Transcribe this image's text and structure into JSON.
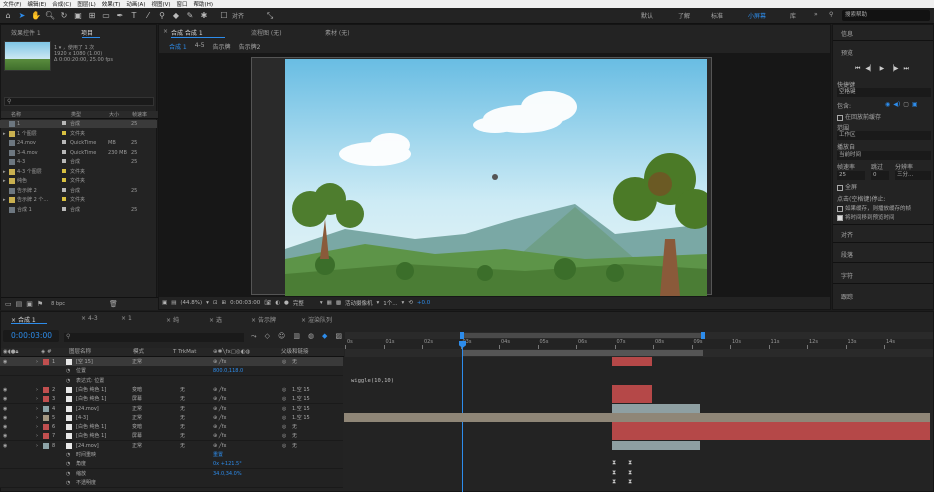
{
  "menu": [
    "文件(F)",
    "编辑(E)",
    "合成(C)",
    "图层(L)",
    "效果(T)",
    "动画(A)",
    "视图(V)",
    "窗口",
    "帮助(H)"
  ],
  "toolbar": {
    "align_label": "对齐",
    "workspaces": [
      "默认",
      "了解",
      "标准",
      "小屏幕",
      "库"
    ],
    "active_workspace": "小屏幕",
    "search_help": "搜索帮助"
  },
  "project_panel": {
    "tabs": [
      "效果控件 1",
      "项目"
    ],
    "item_info": {
      "name": "1",
      "used": "，使用了 1 次",
      "dims": "1920 x 1080 (1.00)",
      "duration": "Δ 0:00:20:00, 25.00 fps"
    },
    "search_placeholder": "",
    "columns": [
      "名称",
      "类型",
      "大小",
      "帧速率"
    ],
    "items": [
      {
        "name": "1",
        "type": "合成",
        "size": "",
        "fps": "25",
        "color": "#b8b8b8"
      },
      {
        "name": "1 个图层",
        "type": "文件夹",
        "size": "",
        "fps": "",
        "color": "#d8c040"
      },
      {
        "name": "24.mov",
        "type": "QuickTime",
        "size": "MB",
        "fps": "25",
        "color": "#b8b8b8"
      },
      {
        "name": "3-4.mov",
        "type": "QuickTime",
        "size": "230 MB",
        "fps": "25",
        "color": "#b8b8b8"
      },
      {
        "name": "4-3",
        "type": "合成",
        "size": "",
        "fps": "25",
        "color": "#b8b8b8"
      },
      {
        "name": "4-3 个图层",
        "type": "文件夹",
        "size": "",
        "fps": "",
        "color": "#d8c040"
      },
      {
        "name": "纯色",
        "type": "文件夹",
        "size": "",
        "fps": "",
        "color": "#d8c040"
      },
      {
        "name": "告示牌 2",
        "type": "合成",
        "size": "",
        "fps": "25",
        "color": "#b8b8b8"
      },
      {
        "name": "告示牌 2 个...",
        "type": "文件夹",
        "size": "",
        "fps": "",
        "color": "#d8c040"
      },
      {
        "name": "合成 1",
        "type": "合成",
        "size": "",
        "fps": "25",
        "color": "#b8b8b8"
      }
    ],
    "bpc": "8 bpc"
  },
  "comp_panel": {
    "tabs": [
      "合成 合成 1",
      "流程图 (无)",
      "素材 (无)"
    ],
    "breadcrumbs": [
      "合成 1",
      "4-5",
      "告示牌",
      "告示牌2"
    ],
    "zoom": "(44.8%)",
    "timecode": "0:00:03:00",
    "quality": "完整",
    "camera": "活动摄像机",
    "views": "1个...",
    "exposure": "+0.0"
  },
  "right_panel": {
    "info": "信息",
    "preview": "预览",
    "shortcut_label": "快捷键",
    "shortcut_value": "空格键",
    "include_label": "包含:",
    "cache_label": "在回放前缓存",
    "range_label": "范围",
    "range_value": "工作区",
    "playfrom_label": "播放自",
    "playfrom_value": "当前时间",
    "fps_label": "帧速率",
    "skip_label": "跳过",
    "res_label": "分辨率",
    "fps_value": "25",
    "skip_value": "0",
    "res_value": "三分...",
    "fullscreen_label": "全屏",
    "stop_label": "点击(空格键)停止:",
    "opt1": "如果缓存，则播放缓存的帧",
    "opt2": "将时间移到预览时间",
    "sections": [
      "对齐",
      "段落",
      "字符",
      "跟踪"
    ]
  },
  "timeline": {
    "tabs": [
      "合成 1",
      "4-3",
      "1",
      "纯",
      "选",
      "告示牌",
      "渲染队列"
    ],
    "timecode": "0:00:03:00",
    "fps_sub": "00075 (25.00 fps)",
    "columns": [
      "图层名称",
      "模式",
      "T TrkMat",
      "父级和链接"
    ],
    "ruler": [
      "0s",
      "01s",
      "02s",
      "03s",
      "04s",
      "05s",
      "06s",
      "07s",
      "08s",
      "09s",
      "10s",
      "11s",
      "12s",
      "13s",
      "14s"
    ],
    "expression": "wiggle(10,10)",
    "rows": [
      {
        "num": "1",
        "name": "[空 15]",
        "mode": "正常",
        "trk": "",
        "parent": "无",
        "color": "#c14f4f",
        "kind": "layer"
      },
      {
        "num": "",
        "name": "位置",
        "mode": "",
        "trk": "",
        "parent": "",
        "value": "800.0,118.0",
        "kind": "prop"
      },
      {
        "num": "",
        "name": "表达式: 位置",
        "mode": "",
        "trk": "",
        "parent": "",
        "value": "",
        "kind": "prop"
      },
      {
        "num": "2",
        "name": "[白色 纯色 1]",
        "mode": "变暗",
        "trk": "无",
        "parent": "1.空 15",
        "color": "#c14f4f",
        "kind": "layer"
      },
      {
        "num": "3",
        "name": "[白色 纯色 1]",
        "mode": "屏幕",
        "trk": "无",
        "parent": "1.空 15",
        "color": "#c14f4f",
        "kind": "layer"
      },
      {
        "num": "4",
        "name": "[24.mov]",
        "mode": "正常",
        "trk": "无",
        "parent": "1.空 15",
        "color": "#8ea4a8",
        "kind": "layer"
      },
      {
        "num": "5",
        "name": "[4-3]",
        "mode": "正常",
        "trk": "无",
        "parent": "1.空 15",
        "color": "#a59882",
        "kind": "layer"
      },
      {
        "num": "6",
        "name": "[白色 纯色 1]",
        "mode": "变暗",
        "trk": "无",
        "parent": "无",
        "color": "#c14f4f",
        "kind": "layer"
      },
      {
        "num": "7",
        "name": "[白色 纯色 1]",
        "mode": "屏幕",
        "trk": "无",
        "parent": "无",
        "color": "#c14f4f",
        "kind": "layer"
      },
      {
        "num": "8",
        "name": "[24.mov]",
        "mode": "正常",
        "trk": "无",
        "parent": "无",
        "color": "#8ea4a8",
        "kind": "layer"
      },
      {
        "num": "",
        "name": "时间重映",
        "mode": "",
        "trk": "",
        "parent": "",
        "value": "重置",
        "kind": "prop"
      },
      {
        "num": "",
        "name": "角度",
        "mode": "",
        "trk": "",
        "parent": "",
        "value": "0x +121.5°",
        "kind": "prop"
      },
      {
        "num": "",
        "name": "缩放",
        "mode": "",
        "trk": "",
        "parent": "",
        "value": "34.0,34.0%",
        "kind": "prop"
      },
      {
        "num": "",
        "name": "不透明度",
        "mode": "",
        "trk": "",
        "parent": "",
        "value": "",
        "kind": "prop"
      }
    ]
  },
  "colors": {
    "accent": "#2d8ceb",
    "layer_red": "#c14f4f",
    "layer_gray": "#8ea4a8",
    "bg": "#1c1c1c"
  }
}
